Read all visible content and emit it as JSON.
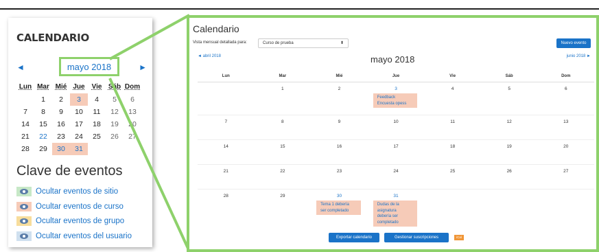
{
  "colors": {
    "accent": "#1a73c8",
    "callout_green": "#8ed16b",
    "event_course_bg": "#f6cbb8",
    "event_site_bg": "#c7e8c7",
    "event_group_bg": "#f7dd9c",
    "event_user_bg": "#cfe0ef",
    "ical_orange": "#f09637"
  },
  "left_block": {
    "heading": "CALENDARIO",
    "prev_arrow": "◄",
    "next_arrow": "►",
    "month": "mayo 2018",
    "weekday_headers": [
      "Lun",
      "Mar",
      "Mié",
      "Jue",
      "Vie",
      "Sáb",
      "Dom"
    ],
    "weeks": [
      [
        "",
        "1",
        "2",
        "3",
        "4",
        "5",
        "6"
      ],
      [
        "7",
        "8",
        "9",
        "10",
        "11",
        "12",
        "13"
      ],
      [
        "14",
        "15",
        "16",
        "17",
        "18",
        "19",
        "20"
      ],
      [
        "21",
        "22",
        "23",
        "24",
        "25",
        "26",
        "27"
      ],
      [
        "28",
        "29",
        "30",
        "31",
        "",
        "",
        ""
      ]
    ],
    "event_key_title": "Clave de eventos",
    "event_key_items": [
      {
        "label": "Ocultar eventos de sitio",
        "icon": "eye-icon"
      },
      {
        "label": "Ocultar eventos de curso",
        "icon": "eye-icon"
      },
      {
        "label": "Ocultar eventos de grupo",
        "icon": "eye-icon"
      },
      {
        "label": "Ocultar eventos del usuario",
        "icon": "eye-icon"
      }
    ]
  },
  "right_block": {
    "title": "Calendario",
    "view_label": "Vista mensual detallada para:",
    "course_select": "Curso de prueba",
    "course_caret": "⬍",
    "new_event_button": "Nuevo evento",
    "prev_month": "◄ abril 2018",
    "next_month": "junio 2018 ►",
    "month_title": "mayo 2018",
    "weekday_headers": [
      "Lun",
      "Mar",
      "Mié",
      "Jue",
      "Vie",
      "Sáb",
      "Dom"
    ],
    "weeks": [
      [
        "",
        "1",
        "2",
        "3",
        "4",
        "5",
        "6"
      ],
      [
        "7",
        "8",
        "9",
        "10",
        "11",
        "12",
        "13"
      ],
      [
        "14",
        "15",
        "16",
        "17",
        "18",
        "19",
        "20"
      ],
      [
        "21",
        "22",
        "23",
        "24",
        "25",
        "26",
        "27"
      ],
      [
        "28",
        "29",
        "30",
        "31",
        "",
        "",
        ""
      ]
    ],
    "events": {
      "may3": [
        "Feedback",
        "Encuesta opess"
      ],
      "may30": [
        "Tema 1 debería",
        "ser completado"
      ],
      "may31": [
        "Dudas de la",
        "asignatura",
        "debería ser",
        "completado"
      ]
    },
    "export_button": "Exportar calendario",
    "subscriptions_button": "Gestionar suscripciones",
    "ical_badge": "iCal"
  }
}
